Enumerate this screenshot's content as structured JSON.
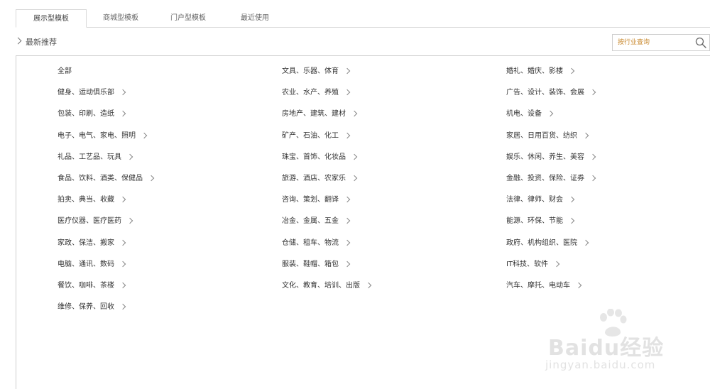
{
  "tabs": [
    {
      "label": "展示型模板",
      "active": true
    },
    {
      "label": "商城型模板",
      "active": false
    },
    {
      "label": "门户型模板",
      "active": false
    },
    {
      "label": "最近使用",
      "active": false
    }
  ],
  "section": {
    "title": "最新推荐"
  },
  "search": {
    "placeholder": "按行业查询"
  },
  "categories": {
    "column1": [
      "全部",
      "健身、运动俱乐部",
      "包装、印刷、造纸",
      "电子、电气、家电、照明",
      "礼品、工艺品、玩具",
      "食品、饮料、酒类、保健品",
      "拍卖、典当、收藏",
      "医疗仪器、医疗医药",
      "家政、保洁、搬家",
      "电脑、通讯、数码",
      "餐饮、咖啡、茶楼",
      "维修、保养、回收"
    ],
    "column2": [
      "文具、乐器、体育",
      "农业、水产、养殖",
      "房地产、建筑、建材",
      "矿产、石油、化工",
      "珠宝、首饰、化妆品",
      "旅游、酒店、农家乐",
      "咨询、策划、翻译",
      "冶金、金属、五金",
      "仓储、租车、物流",
      "服装、鞋帽、箱包",
      "文化、教育、培训、出版"
    ],
    "column3": [
      "婚礼、婚庆、影楼",
      "广告、设计、装饰、会展",
      "机电、设备",
      "家居、日用百货、纺织",
      "娱乐、休闲、养生、美容",
      "金融、投资、保险、证券",
      "法律、律师、财会",
      "能源、环保、节能",
      "政府、机构组织、医院",
      "IT科技、软件",
      "汽车、摩托、电动车"
    ]
  },
  "watermark": {
    "brand": "Baidu经验",
    "url": "jingyan.baidu.com"
  },
  "colors": {
    "accent": "#c9892f",
    "border": "#cfcfcf",
    "text": "#333333"
  }
}
